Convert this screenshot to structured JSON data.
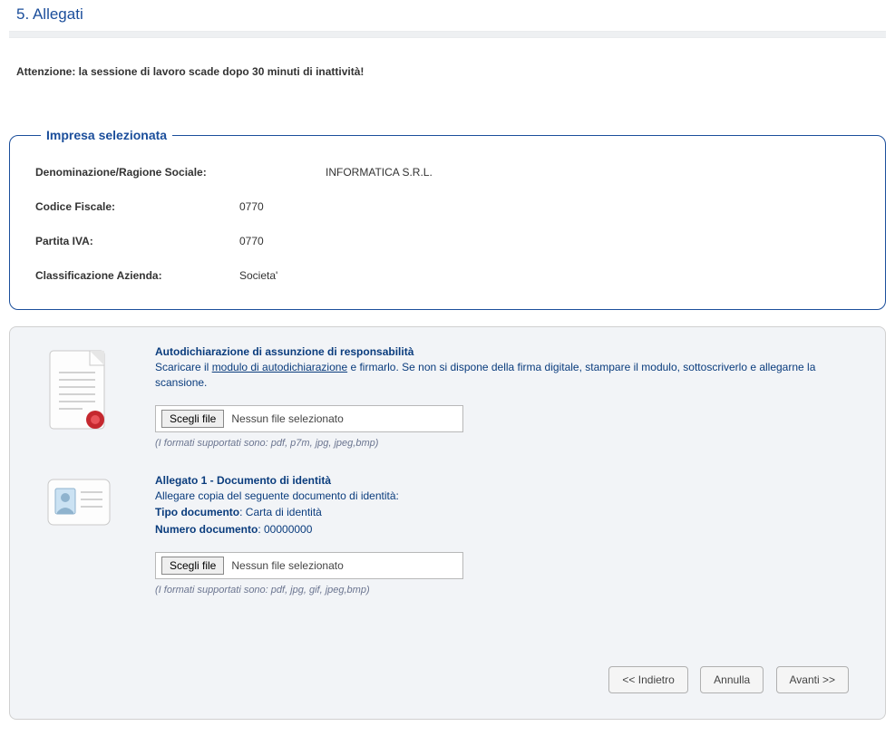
{
  "section": {
    "title": "5. Allegati"
  },
  "warning": "Attenzione: la sessione di lavoro scade dopo 30 minuti di inattività!",
  "company_box": {
    "legend": "Impresa selezionata",
    "rows": [
      {
        "label": "Denominazione/Ragione Sociale:",
        "value": "INFORMATICA S.R.L."
      },
      {
        "label": "Codice Fiscale:",
        "value": "0770"
      },
      {
        "label": "Partita IVA:",
        "value": "0770"
      },
      {
        "label": "Classificazione Azienda:",
        "value": "Societa'"
      }
    ]
  },
  "attachments": {
    "item1": {
      "title": "Autodichiarazione di assunzione di responsabilità",
      "desc_prefix": "Scaricare il ",
      "desc_link": "modulo di autodichiarazione",
      "desc_suffix": " e firmarlo. Se non si dispone della firma digitale, stampare il modulo, sottoscriverlo e allegarne la scansione.",
      "choose_label": "Scegli file",
      "no_file": "Nessun file selezionato",
      "formats": "(I formati supportati sono: pdf, p7m, jpg, jpeg,bmp)"
    },
    "item2": {
      "title": "Allegato 1 - Documento di identità",
      "desc_line1": "Allegare copia del seguente documento di identità:",
      "tipo_label": "Tipo documento",
      "tipo_value": ": Carta di identità",
      "numero_label": "Numero documento",
      "numero_value": ": 00000000",
      "choose_label": "Scegli file",
      "no_file": "Nessun file selezionato",
      "formats": "(I formati supportati sono: pdf, jpg, gif, jpeg,bmp)"
    }
  },
  "footer": {
    "back": "<< Indietro",
    "cancel": "Annulla",
    "next": "Avanti >>"
  }
}
